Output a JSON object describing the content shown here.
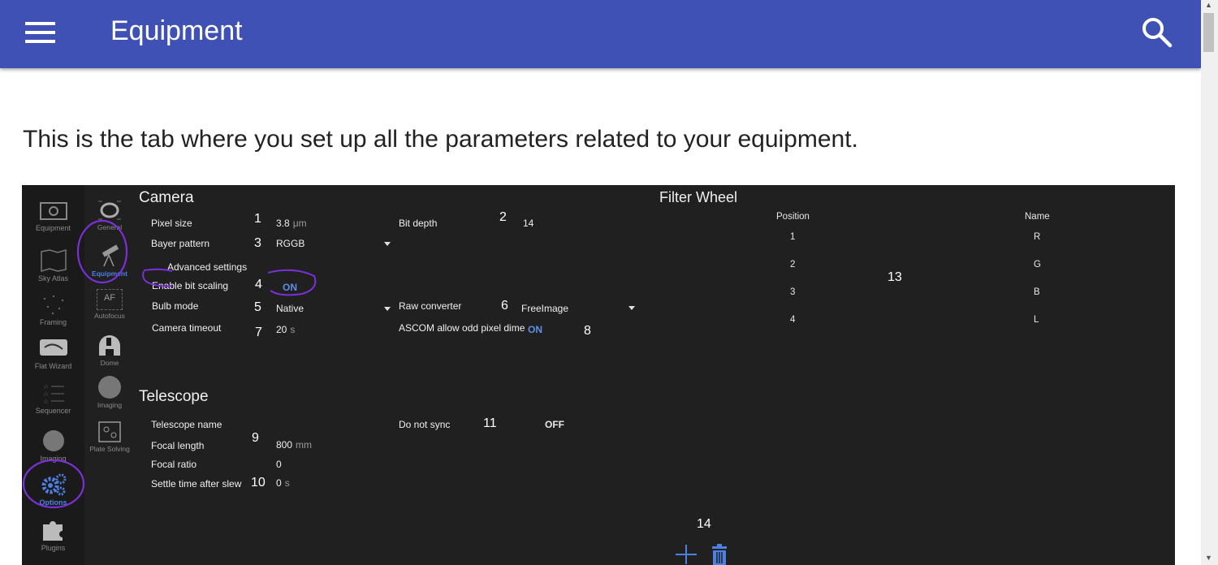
{
  "appbar": {
    "title": "Equipment",
    "menu_icon": "hamburger-menu-icon",
    "search_icon": "search-icon",
    "color": "#3f51b5"
  },
  "intro_text": "This is the tab where you set up all the parameters related to your equipment.",
  "screenshot": {
    "left_nav": [
      {
        "label": "Equipment",
        "icon": "camera-icon"
      },
      {
        "label": "Sky Atlas",
        "icon": "map-icon"
      },
      {
        "label": "Framing",
        "icon": "stars-icon"
      },
      {
        "label": "Flat Wizard",
        "icon": "flat-panel-icon"
      },
      {
        "label": "Sequencer",
        "icon": "list-icon"
      },
      {
        "label": "Imaging",
        "icon": "planet-icon"
      },
      {
        "label": "Options",
        "icon": "gears-icon",
        "active": true
      },
      {
        "label": "Plugins",
        "icon": "puzzle-icon"
      }
    ],
    "sub_nav": [
      {
        "label": "General",
        "icon": "logo-icon"
      },
      {
        "label": "Equipment",
        "icon": "telescope-icon",
        "active": true
      },
      {
        "label": "Autofocus",
        "icon": "af-icon",
        "icon_text": "AF"
      },
      {
        "label": "Dome",
        "icon": "dome-icon"
      },
      {
        "label": "Imaging",
        "icon": "planet-icon"
      },
      {
        "label": "Plate Solving",
        "icon": "plate-solve-icon"
      }
    ],
    "camera": {
      "title": "Camera",
      "pixel_size_label": "Pixel size",
      "pixel_size_value": "3.8",
      "pixel_size_unit": "μm",
      "bit_depth_label": "Bit depth",
      "bit_depth_value": "14",
      "bayer_label": "Bayer pattern",
      "bayer_value": "RGGB",
      "advanced_label": "Advanced settings",
      "bit_scaling_label": "Enable bit scaling",
      "bit_scaling_value": "ON",
      "bulb_label": "Bulb mode",
      "bulb_value": "Native",
      "raw_label": "Raw converter",
      "raw_value": "FreeImage",
      "timeout_label": "Camera timeout",
      "timeout_value": "20",
      "timeout_unit": "s",
      "ascom_label": "ASCOM allow odd pixel dime",
      "ascom_value": "ON"
    },
    "telescope": {
      "title": "Telescope",
      "name_label": "Telescope name",
      "no_sync_label": "Do not sync",
      "no_sync_value": "OFF",
      "focal_length_label": "Focal length",
      "focal_length_value": "800",
      "focal_length_unit": "mm",
      "focal_ratio_label": "Focal ratio",
      "focal_ratio_value": "0",
      "settle_label": "Settle time after slew",
      "settle_value": "0",
      "settle_unit": "s"
    },
    "filter_wheel": {
      "title": "Filter Wheel",
      "col_position": "Position",
      "col_name": "Name",
      "rows": [
        {
          "position": "1",
          "name": "R"
        },
        {
          "position": "2",
          "name": "G"
        },
        {
          "position": "3",
          "name": "B"
        },
        {
          "position": "4",
          "name": "L"
        }
      ],
      "add_icon": "plus-icon",
      "delete_icon": "trash-icon"
    },
    "annotations": [
      "1",
      "2",
      "3",
      "4",
      "5",
      "6",
      "7",
      "8",
      "9",
      "10",
      "11",
      "13",
      "14"
    ],
    "annotation_color": "#7b2fd6",
    "accent": "#5e8fe8"
  }
}
